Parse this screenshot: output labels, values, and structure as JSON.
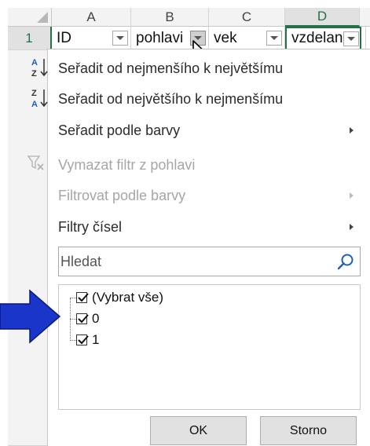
{
  "columns": [
    {
      "letter": "A",
      "header": "ID"
    },
    {
      "letter": "B",
      "header": "pohlavi"
    },
    {
      "letter": "C",
      "header": "vek"
    },
    {
      "letter": "D",
      "header": "vzdelan"
    }
  ],
  "row_number": "1",
  "menu": {
    "sort_asc": "Seřadit od nejmenšího k největšímu",
    "sort_desc": "Seřadit od největšího k nejmenšímu",
    "sort_by_color": "Seřadit podle barvy",
    "clear_filter": "Vymazat filtr z pohlavi",
    "filter_by_color": "Filtrovat podle barvy",
    "number_filters": "Filtry čísel"
  },
  "icons": {
    "sort_asc": "sort-a-z-icon",
    "sort_desc": "sort-z-a-icon",
    "clear_filter": "clear-filter-icon",
    "search": "magnifier-icon",
    "submenu": "chevron-right-icon",
    "dropdown": "triangle-down-icon",
    "annotation": "blue-arrow-icon"
  },
  "search": {
    "placeholder": "Hledat"
  },
  "values": [
    {
      "label": "(Vybrat vše)",
      "checked": true
    },
    {
      "label": "0",
      "checked": true
    },
    {
      "label": "1",
      "checked": true
    }
  ],
  "buttons": {
    "ok": "OK",
    "cancel": "Storno"
  },
  "colors": {
    "accent": "#217346",
    "arrow": "#1a35c9"
  }
}
